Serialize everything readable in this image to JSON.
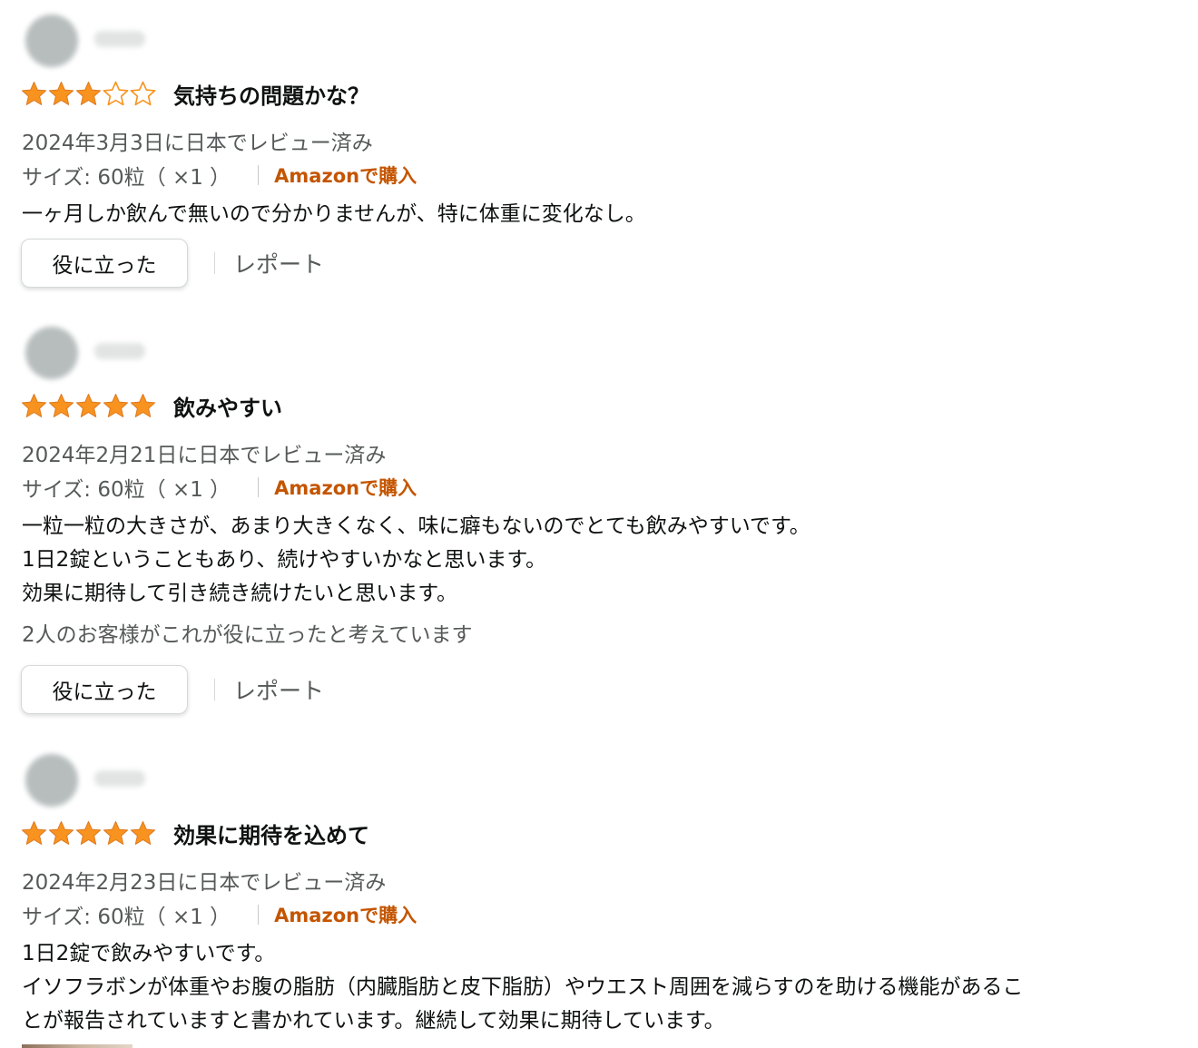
{
  "colors": {
    "star": "#f7931e",
    "verified": "#c45500",
    "muted": "#565959",
    "text": "#0f1111"
  },
  "reviews": [
    {
      "rating": 3,
      "title": "気持ちの問題かな？",
      "date": "2024年3月3日に日本でレビュー済み",
      "size": "サイズ: 60粒（ ×1 ）",
      "verified": "Amazonで購入",
      "body": "一ヶ月しか飲んで無いので分かりませんが、特に体重に変化なし。",
      "helpful_count": "",
      "helpful_label": "役に立った",
      "report_label": "レポート"
    },
    {
      "rating": 5,
      "title": "飲みやすい",
      "date": "2024年2月21日に日本でレビュー済み",
      "size": "サイズ: 60粒（ ×1 ）",
      "verified": "Amazonで購入",
      "body": "一粒一粒の大きさが、あまり大きくなく、味に癖もないのでとても飲みやすいです。\n1日2錠ということもあり、続けやすいかなと思います。\n効果に期待して引き続き続けたいと思います。",
      "helpful_count": "2人のお客様がこれが役に立ったと考えています",
      "helpful_label": "役に立った",
      "report_label": "レポート"
    },
    {
      "rating": 5,
      "title": "効果に期待を込めて",
      "date": "2024年2月23日に日本でレビュー済み",
      "size": "サイズ: 60粒（ ×1 ）",
      "verified": "Amazonで購入",
      "body": "1日2錠で飲みやすいです。\nイソフラボンが体重やお腹の脂肪（内臓脂肪と皮下脂肪）やウエスト周囲を減らすのを助ける機能があるこ\nとが報告されていますと書かれています。継続して効果に期待しています。",
      "helpful_count": "",
      "helpful_label": "",
      "report_label": ""
    }
  ]
}
